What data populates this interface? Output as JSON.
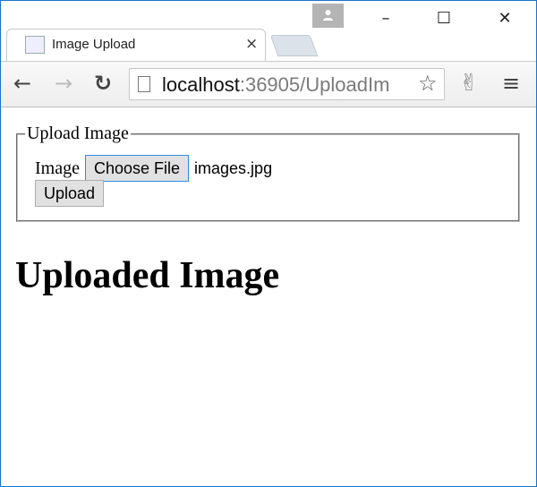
{
  "browser": {
    "tab_title": "Image Upload",
    "tab_close": "×",
    "url_host": "localhost",
    "url_rest": ":36905/UploadIm",
    "icons": {
      "back": "arrow-left-icon",
      "forward": "arrow-right-icon",
      "reload": "reload-icon",
      "star": "star-icon",
      "extension": "extension-icon",
      "menu": "menu-icon"
    },
    "window": {
      "minimize": "–",
      "maximize": "☐",
      "close": "✕"
    }
  },
  "page": {
    "fieldset_legend": "Upload Image",
    "image_label": "Image",
    "choose_file_label": "Choose File",
    "file_name": "images.jpg",
    "upload_label": "Upload",
    "heading": "Uploaded Image"
  }
}
